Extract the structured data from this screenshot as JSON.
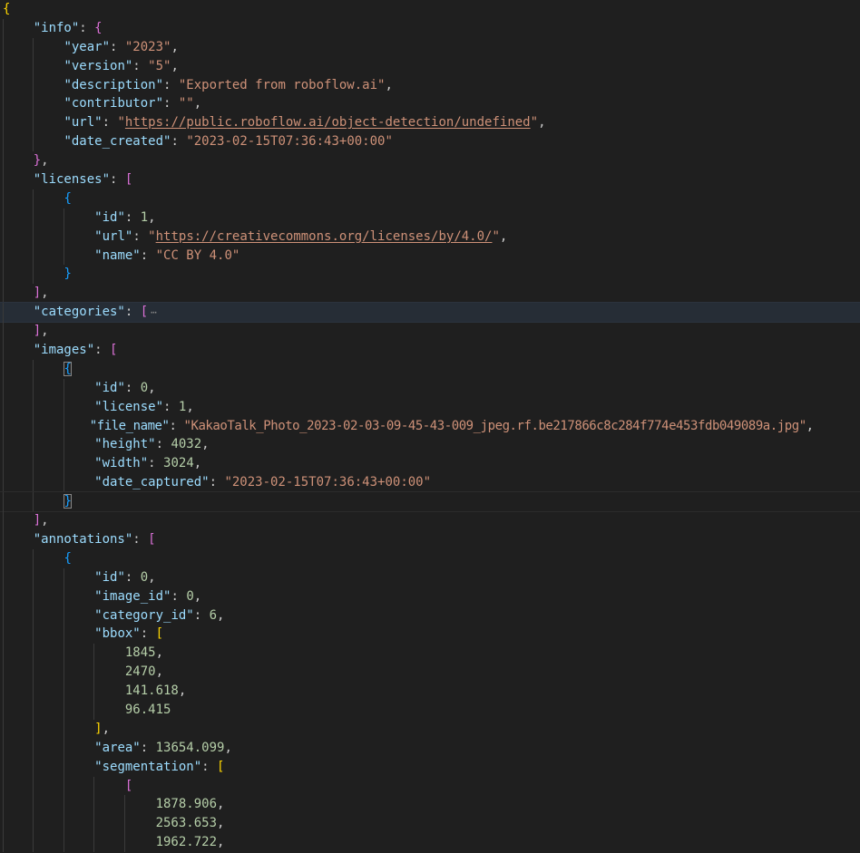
{
  "file_content": {
    "info_key": "\"info\"",
    "year_key": "\"year\"",
    "year_value": "\"2023\"",
    "version_key": "\"version\"",
    "version_value": "\"5\"",
    "description_key": "\"description\"",
    "description_value": "\"Exported from roboflow.ai\"",
    "contributor_key": "\"contributor\"",
    "contributor_value": "\"\"",
    "url_key": "\"url\"",
    "url_value_quote_open": "\"",
    "url_value_link": "https://public.roboflow.ai/object-detection/undefined",
    "url_value_quote_close": "\"",
    "date_created_key": "\"date_created\"",
    "date_created_value": "\"2023-02-15T07:36:43+00:00\"",
    "licenses_key": "\"licenses\"",
    "license_id_key": "\"id\"",
    "license_id_value": "1",
    "license_url_key": "\"url\"",
    "license_url_link": "https://creativecommons.org/licenses/by/4.0/",
    "license_name_key": "\"name\"",
    "license_name_value": "\"CC BY 4.0\"",
    "categories_key": "\"categories\"",
    "fold_marker": "⋯",
    "images_key": "\"images\"",
    "image_id_key": "\"id\"",
    "image_id_value": "0",
    "image_license_key": "\"license\"",
    "image_license_value": "1",
    "file_name_key": "\"file_name\"",
    "file_name_value": "\"KakaoTalk_Photo_2023-02-03-09-45-43-009_jpeg.rf.be217866c8c284f774e453fdb049089a.jpg\"",
    "height_key": "\"height\"",
    "height_value": "4032",
    "width_key": "\"width\"",
    "width_value": "3024",
    "date_captured_key": "\"date_captured\"",
    "date_captured_value": "\"2023-02-15T07:36:43+00:00\"",
    "annotations_key": "\"annotations\"",
    "ann_id_key": "\"id\"",
    "ann_id_value": "0",
    "image_id_key2": "\"image_id\"",
    "image_id_value2": "0",
    "category_id_key": "\"category_id\"",
    "category_id_value": "6",
    "bbox_key": "\"bbox\"",
    "bbox_values": [
      "1845",
      "2470",
      "141.618",
      "96.415"
    ],
    "area_key": "\"area\"",
    "area_value": "13654.099",
    "segmentation_key": "\"segmentation\"",
    "segmentation_values": [
      "1878.906",
      "2563.653",
      "1962.722"
    ]
  },
  "colors": {
    "background": "#1f1f1f",
    "key": "#9cdcfe",
    "string": "#ce9178",
    "number": "#b5cea8",
    "bracket_level1": "#ffd700",
    "bracket_level2": "#da70d6",
    "bracket_level3": "#179fff"
  }
}
